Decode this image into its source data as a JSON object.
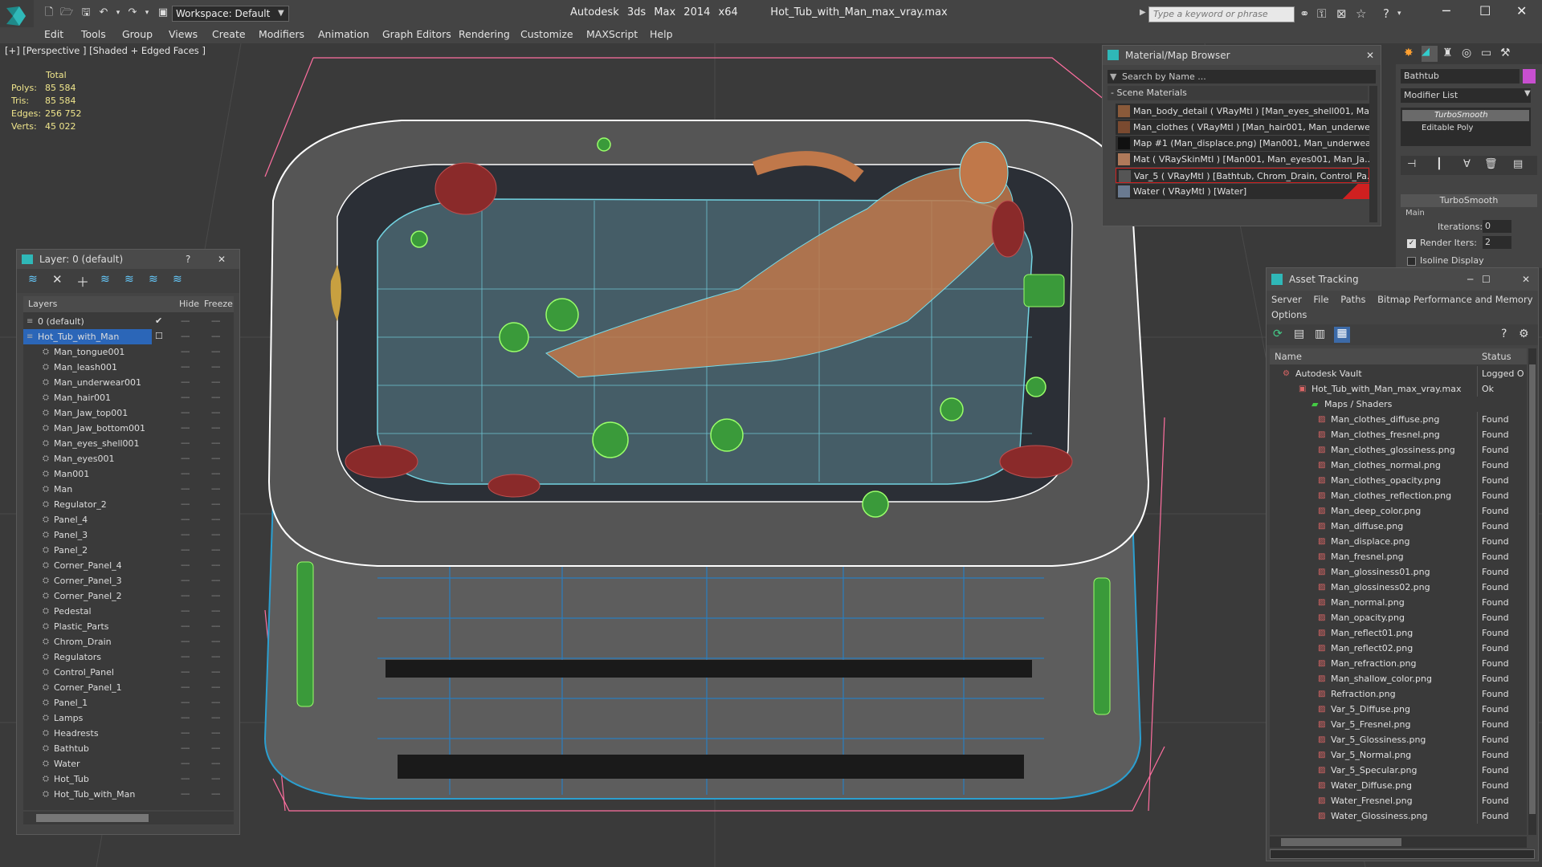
{
  "window": {
    "app_title": "Autodesk 3ds Max  2014 x64",
    "file_title": "Hot_Tub_with_Man_max_vray.max",
    "workspace": "Workspace: Default",
    "search_placeholder": "Type a keyword or phrase"
  },
  "menu": [
    "Edit",
    "Tools",
    "Group",
    "Views",
    "Create",
    "Modifiers",
    "Animation",
    "Graph Editors",
    "Rendering",
    "Customize",
    "MAXScript",
    "Help"
  ],
  "viewport": {
    "label": "[+] [Perspective ] [Shaded + Edged Faces ]",
    "stats": {
      "header": "Total",
      "rows": [
        {
          "k": "Polys:",
          "v": "85 584"
        },
        {
          "k": "Tris:",
          "v": "85 584"
        },
        {
          "k": "Edges:",
          "v": "256 752"
        },
        {
          "k": "Verts:",
          "v": "45 022"
        }
      ]
    }
  },
  "layer_panel": {
    "title": "Layer: 0 (default)",
    "help": "?",
    "close": "✕",
    "col_layers": "Layers",
    "col_hide": "Hide",
    "col_freeze": "Freeze",
    "layers": [
      "0 (default)",
      "Hot_Tub_with_Man",
      "Man_tongue001",
      "Man_leash001",
      "Man_underwear001",
      "Man_hair001",
      "Man_Jaw_top001",
      "Man_Jaw_bottom001",
      "Man_eyes_shell001",
      "Man_eyes001",
      "Man001",
      "Man",
      "Regulator_2",
      "Panel_4",
      "Panel_3",
      "Panel_2",
      "Corner_Panel_4",
      "Corner_Panel_3",
      "Corner_Panel_2",
      "Pedestal",
      "Plastic_Parts",
      "Chrom_Drain",
      "Regulators",
      "Control_Panel",
      "Corner_Panel_1",
      "Panel_1",
      "Lamps",
      "Headrests",
      "Bathtub",
      "Water",
      "Hot_Tub",
      "Hot_Tub_with_Man"
    ]
  },
  "material_browser": {
    "title": "Material/Map Browser",
    "search": "Search by Name ...",
    "section": "- Scene Materials",
    "items": [
      {
        "label": "Man_body_detail  ( VRayMtl ) [Man_eyes_shell001, Ma...",
        "swatch": "#8a5a3a"
      },
      {
        "label": "Man_clothes  ( VRayMtl ) [Man_hair001, Man_underwe...",
        "swatch": "#7a4a30"
      },
      {
        "label": "Map #1 (Man_displace.png)  [Man001, Man_underwear...",
        "swatch": "#111111"
      },
      {
        "label": "Mat  ( VRaySkinMtl ) [Man001, Man_eyes001, Man_Ja...",
        "swatch": "#b07a5a"
      },
      {
        "label": "Var_5  ( VRayMtl ) [Bathtub, Chrom_Drain, Control_Pa...",
        "swatch": "#555555"
      },
      {
        "label": "Water  ( VRayMtl ) [Water]",
        "swatch": "#6a7a90"
      }
    ]
  },
  "command_panel": {
    "object_name": "Bathtub",
    "modifier_list": "Modifier List",
    "modifiers": [
      "TurboSmooth",
      "Editable Poly"
    ],
    "rollout": "TurboSmooth",
    "group": "Main",
    "iterations_label": "Iterations:",
    "iterations": "0",
    "render_iters_label": "Render Iters:",
    "render_iters": "2",
    "isoline": "Isoline Display"
  },
  "asset_tracking": {
    "title": "Asset Tracking",
    "menu": [
      "Server",
      "File",
      "Paths",
      "Bitmap Performance and Memory"
    ],
    "options": "Options",
    "col_name": "Name",
    "col_status": "Status",
    "vault": {
      "name": "Autodesk Vault",
      "status": "Logged O"
    },
    "file": {
      "name": "Hot_Tub_with_Man_max_vray.max",
      "status": "Ok"
    },
    "folder": "Maps / Shaders",
    "maps": [
      "Man_clothes_diffuse.png",
      "Man_clothes_fresnel.png",
      "Man_clothes_glossiness.png",
      "Man_clothes_normal.png",
      "Man_clothes_opacity.png",
      "Man_clothes_reflection.png",
      "Man_deep_color.png",
      "Man_diffuse.png",
      "Man_displace.png",
      "Man_fresnel.png",
      "Man_glossiness01.png",
      "Man_glossiness02.png",
      "Man_normal.png",
      "Man_opacity.png",
      "Man_reflect01.png",
      "Man_reflect02.png",
      "Man_refraction.png",
      "Man_shallow_color.png",
      "Refraction.png",
      "Var_5_Diffuse.png",
      "Var_5_Fresnel.png",
      "Var_5_Glossiness.png",
      "Var_5_Normal.png",
      "Var_5_Specular.png",
      "Water_Diffuse.png",
      "Water_Fresnel.png",
      "Water_Glossiness.png"
    ],
    "found": "Found"
  }
}
